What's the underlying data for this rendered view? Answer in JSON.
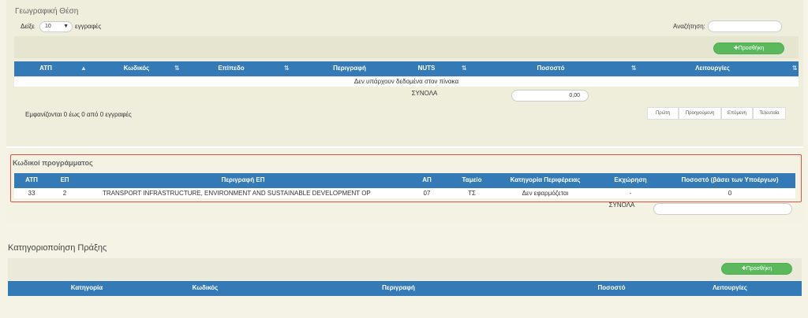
{
  "geo": {
    "title": "Γεωγραφική Θέση",
    "show_prefix": "Δείξε",
    "page_size": "10",
    "show_suffix": "εγγραφές",
    "search_label": "Αναζήτηση:",
    "search_value": "",
    "add_label": "✚Προσθήκη",
    "columns": [
      "ΑΤΠ",
      "Κωδικός",
      "Επίπεδο",
      "Περιγραφή",
      "NUTS",
      "Ποσοστό",
      "Λειτουργίες"
    ],
    "empty_message": "Δεν υπάρχουν δεδομένα στον πίνακα",
    "totals_label": "ΣΥΝΟΛΑ",
    "totals_value": "0,00",
    "info": "Εμφανίζονται 0 έως 0 από 0 εγγραφές",
    "pager": [
      "Πρώτη",
      "Προηγούμενη",
      "Επόμενη",
      "Τελευταία"
    ]
  },
  "codes": {
    "title": "Κωδικοί προγράμματος",
    "columns": [
      "ΑΤΠ",
      "ΕΠ",
      "Περιγραφή ΕΠ",
      "ΑΠ",
      "Ταμείο",
      "Κατηγορία Περιφέρειας",
      "Εκχώρηση",
      "Ποσοστό (βάσει των Υποέργων)"
    ],
    "rows": [
      [
        "33",
        "2",
        "TRANSPORT INFRASTRUCTURE, ENVIRONMENT AND SUSTAINABLE DEVELOPMENT OP",
        "07",
        "ΤΣ",
        "Δεν εφαρμόζεται",
        "-",
        "0"
      ]
    ],
    "totals_label": "ΣΥΝΟΛΑ",
    "totals_value": ""
  },
  "category": {
    "title": "Κατηγοριοποίηση Πράξης",
    "add_label": "✚Προσθήκη",
    "columns": [
      "Κατηγορία",
      "Κωδικός",
      "Περιγραφή",
      "Ποσοστό",
      "Λειτουργίες"
    ]
  },
  "colors": {
    "header_blue": "#337ab7",
    "add_green": "#5cb85c",
    "highlight_red": "#d9534f"
  }
}
